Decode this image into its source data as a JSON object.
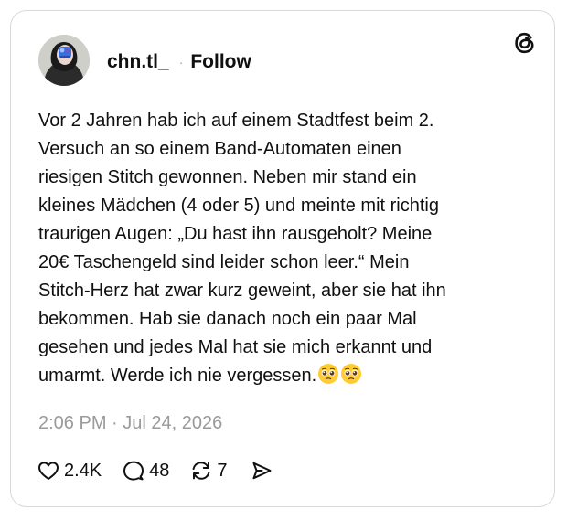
{
  "post": {
    "username": "chn.tl_",
    "separator": "·",
    "follow_label": "Follow",
    "text_lines": [
      "Vor 2 Jahren hab ich auf einem Stadtfest beim 2.",
      "Versuch an so einem Band-Automaten einen",
      "riesigen Stitch gewonnen. Neben mir stand ein",
      "kleines Mädchen (4 oder 5) und meinte mit richtig",
      "traurigen Augen: „Du hast ihn rausgeholt? Meine",
      "20€ Taschengeld sind leider schon leer.“ Mein",
      "Stitch-Herz hat zwar kurz geweint, aber sie hat ihn",
      "bekommen. Hab sie danach noch ein paar Mal",
      "gesehen und jedes Mal hat sie mich erkannt und",
      "umarmt. Werde ich nie vergessen."
    ],
    "trailing_emoji": [
      "pleading-face-emoji",
      "pleading-face-emoji"
    ],
    "timestamp": "2:06 PM · Jul 24, 2026"
  },
  "actions": {
    "likes": "2.4K",
    "replies": "48",
    "reposts": "7"
  },
  "icons": {
    "logo": "threads-logo-icon",
    "like": "heart-icon",
    "reply": "speech-bubble-icon",
    "repost": "repost-icon",
    "share": "send-icon"
  },
  "colors": {
    "text": "#101010",
    "muted": "#9a9a9a",
    "border": "#d9d9d9",
    "background": "#ffffff"
  }
}
